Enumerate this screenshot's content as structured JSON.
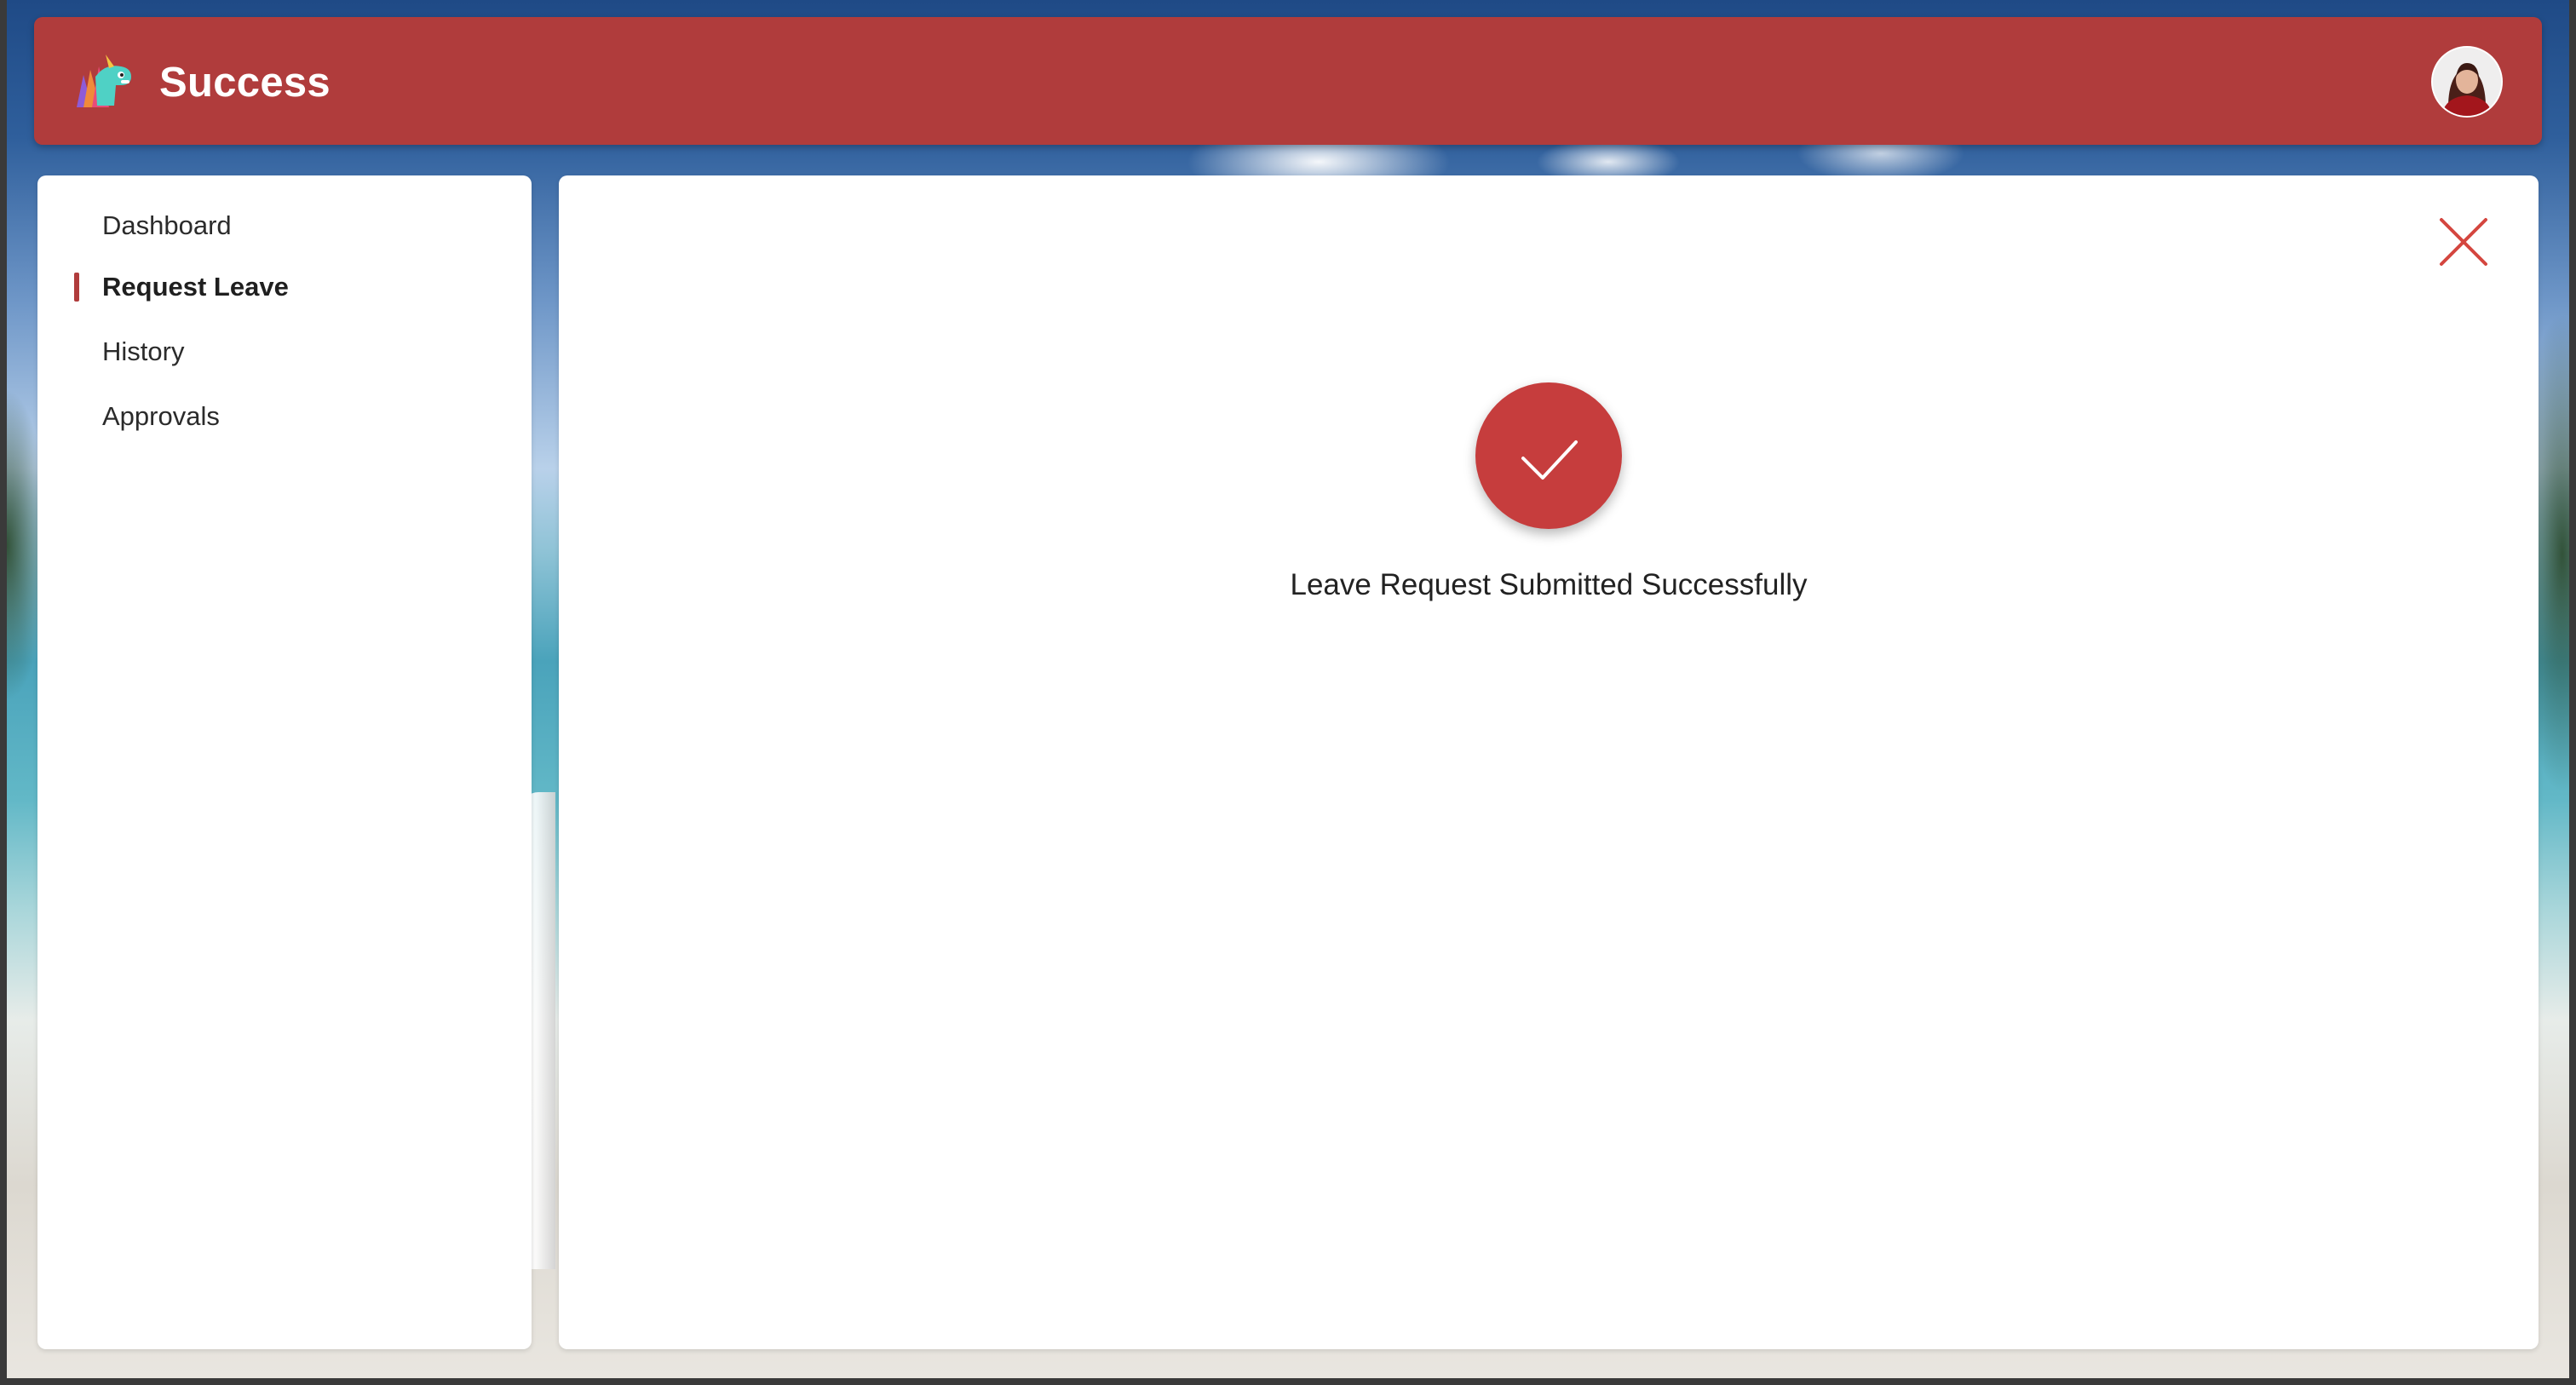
{
  "header": {
    "title": "Success",
    "logo_icon": "unicorn-logo-icon",
    "avatar_icon": "user-avatar-icon",
    "background_color": "#b03c3c"
  },
  "sidebar": {
    "items": [
      {
        "label": "Dashboard",
        "active": false
      },
      {
        "label": "Request Leave",
        "active": true
      },
      {
        "label": "History",
        "active": false
      },
      {
        "label": "Approvals",
        "active": false
      }
    ],
    "active_indicator_color": "#b03c3c"
  },
  "main": {
    "close_icon": "close-icon",
    "success_icon": "checkmark-circle-icon",
    "success_color": "#c63d3d",
    "message": "Leave Request Submitted Successfully"
  }
}
